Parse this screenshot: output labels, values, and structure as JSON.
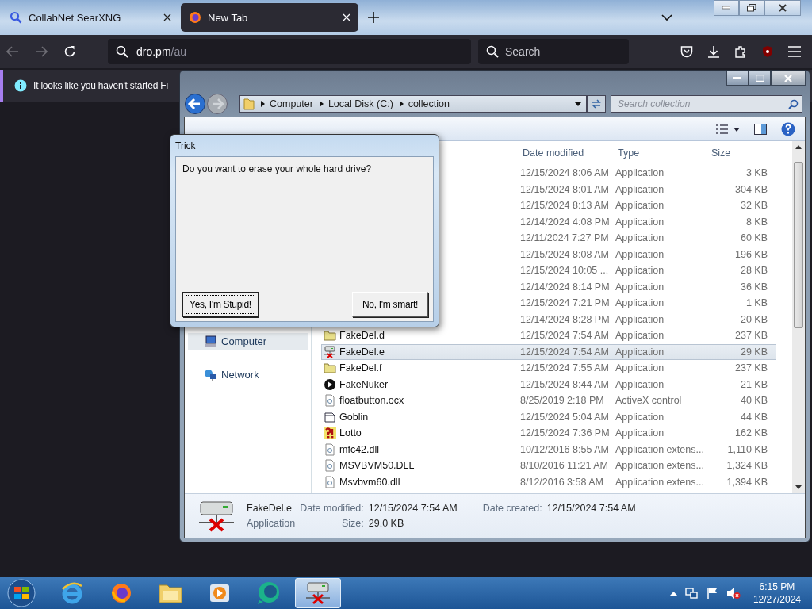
{
  "browser": {
    "tabs": [
      {
        "title": "CollabNet SearXNG",
        "kind": "search",
        "selected": false
      },
      {
        "title": "New Tab",
        "kind": "firefox",
        "selected": true
      }
    ],
    "address": {
      "host": "dro.pm",
      "path": "/au"
    },
    "search": {
      "placeholder": "Search"
    },
    "notification": {
      "text": "It looks like you haven't started Fi"
    }
  },
  "explorer": {
    "breadcrumbs": [
      "Computer",
      "Local Disk (C:)",
      "collection"
    ],
    "search": {
      "placeholder": "Search collection"
    },
    "nav_items": [
      {
        "label": "Computer",
        "kind": "computer",
        "selected": true
      },
      {
        "label": "Network",
        "kind": "network",
        "selected": false
      }
    ],
    "columns": [
      "Date modified",
      "Type",
      "Size"
    ],
    "rows": [
      {
        "date": "12/15/2024 8:06 AM",
        "type": "Application",
        "size": "3 KB",
        "selected": false
      },
      {
        "date": "12/15/2024 8:01 AM",
        "type": "Application",
        "size": "304 KB",
        "selected": false
      },
      {
        "date": "12/15/2024 8:13 AM",
        "type": "Application",
        "size": "32 KB",
        "selected": false
      },
      {
        "date": "12/14/2024 4:08 PM",
        "type": "Application",
        "size": "8 KB",
        "selected": false
      },
      {
        "date": "12/11/2024 7:27 PM",
        "type": "Application",
        "size": "60 KB",
        "selected": false
      },
      {
        "date": "12/15/2024 8:08 AM",
        "type": "Application",
        "size": "196 KB",
        "selected": false
      },
      {
        "date": "12/15/2024 10:05 ...",
        "type": "Application",
        "size": "28 KB",
        "selected": false
      },
      {
        "date": "12/14/2024 8:14 PM",
        "type": "Application",
        "size": "36 KB",
        "selected": false
      },
      {
        "date": "12/15/2024 7:21 PM",
        "type": "Application",
        "size": "1 KB",
        "selected": false
      },
      {
        "date": "12/14/2024 8:28 PM",
        "type": "Application",
        "size": "20 KB",
        "selected": false
      },
      {
        "name": "FakeDel.d",
        "kind": "folder",
        "date": "12/15/2024 7:54 AM",
        "type": "Application",
        "size": "237 KB",
        "selected": false
      },
      {
        "name": "FakeDel.e",
        "kind": "server",
        "date": "12/15/2024 7:54 AM",
        "type": "Application",
        "size": "29 KB",
        "selected": true
      },
      {
        "name": "FakeDel.f",
        "kind": "folder",
        "date": "12/15/2024 7:55 AM",
        "type": "Application",
        "size": "237 KB",
        "selected": false
      },
      {
        "name": "FakeNuker",
        "kind": "play",
        "date": "12/15/2024 8:44 AM",
        "type": "Application",
        "size": "21 KB",
        "selected": false
      },
      {
        "name": "floatbutton.ocx",
        "kind": "file",
        "date": "8/25/2019 2:18 PM",
        "type": "ActiveX control",
        "size": "40 KB",
        "selected": false
      },
      {
        "name": "Goblin",
        "kind": "window",
        "date": "12/15/2024 5:04 AM",
        "type": "Application",
        "size": "44 KB",
        "selected": false
      },
      {
        "name": "Lotto",
        "kind": "tile",
        "date": "12/15/2024 7:36 PM",
        "type": "Application",
        "size": "162 KB",
        "selected": false
      },
      {
        "name": "mfc42.dll",
        "kind": "file",
        "date": "10/12/2016 8:55 AM",
        "type": "Application extens...",
        "size": "1,110 KB",
        "selected": false
      },
      {
        "name": "MSVBVM50.DLL",
        "kind": "file",
        "date": "8/10/2016 11:21 AM",
        "type": "Application extens...",
        "size": "1,324 KB",
        "selected": false
      },
      {
        "name": "Msvbvm60.dll",
        "kind": "file",
        "date": "8/12/2016 3:58 AM",
        "type": "Application extens...",
        "size": "1,394 KB",
        "selected": false
      }
    ],
    "details": {
      "name": "FakeDel.e",
      "type": "Application",
      "modified_label": "Date modified:",
      "modified": "12/15/2024 7:54 AM",
      "size_label": "Size:",
      "size": "29.0 KB",
      "created_label": "Date created:",
      "created": "12/15/2024 7:54 AM"
    }
  },
  "dialog": {
    "title": "Trick",
    "message": "Do you want to erase your whole hard drive?",
    "buttons": [
      {
        "label": "Yes, I'm Stupid!",
        "focused": true
      },
      {
        "label": "No, I'm smart!",
        "focused": false
      }
    ]
  },
  "taskbar": {
    "apps": [
      {
        "kind": "ie",
        "active": false
      },
      {
        "kind": "firefox",
        "active": false
      },
      {
        "kind": "folder",
        "active": false
      },
      {
        "kind": "media",
        "active": false
      },
      {
        "kind": "bubble",
        "active": false
      },
      {
        "kind": "server",
        "active": true
      }
    ],
    "time": "6:15 PM",
    "date": "12/27/2024"
  }
}
